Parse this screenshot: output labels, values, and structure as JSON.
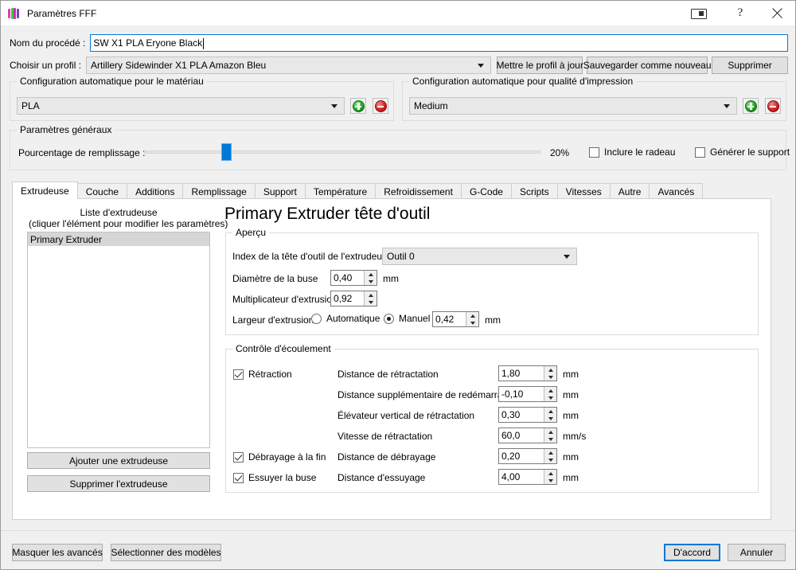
{
  "window": {
    "title": "Paramètres FFF",
    "icon": "fff-logo-icon",
    "controls": {
      "restore": "restore-icon",
      "help": "?",
      "close": "close-icon"
    }
  },
  "top": {
    "process_name_label": "Nom du procédé :",
    "process_name_value": "SW X1 PLA Eryone Black",
    "profile_label": "Choisir un profil :",
    "profile_value": "Artillery Sidewinder X1 PLA Amazon Bleu",
    "update_profile_button": "Mettre le profil à jour",
    "save_as_new_button": "Sauvegarder comme nouveau",
    "delete_button": "Supprimer"
  },
  "material_group": {
    "title": "Configuration automatique pour le matériau",
    "value": "PLA",
    "add_button": "add-icon",
    "remove_button": "remove-icon"
  },
  "quality_group": {
    "title": "Configuration automatique pour qualité d'impression",
    "value": "Medium",
    "add_button": "add-icon",
    "remove_button": "remove-icon"
  },
  "general_group": {
    "title": "Paramètres généraux",
    "infill_label": "Pourcentage de remplissage :",
    "infill_value": "20%",
    "infill_percent": 20,
    "raft_label": "Inclure le radeau",
    "raft_checked": false,
    "support_label": "Générer le support",
    "support_checked": false
  },
  "tabs": [
    {
      "label": "Extrudeuse",
      "active": true
    },
    {
      "label": "Couche",
      "active": false
    },
    {
      "label": "Additions",
      "active": false
    },
    {
      "label": "Remplissage",
      "active": false
    },
    {
      "label": "Support",
      "active": false
    },
    {
      "label": "Température",
      "active": false
    },
    {
      "label": "Refroidissement",
      "active": false
    },
    {
      "label": "G-Code",
      "active": false
    },
    {
      "label": "Scripts",
      "active": false
    },
    {
      "label": "Vitesses",
      "active": false
    },
    {
      "label": "Autre",
      "active": false
    },
    {
      "label": "Avancés",
      "active": false
    }
  ],
  "extruder_panel": {
    "list_title_line1": "Liste d'extrudeuse",
    "list_title_line2": "(cliquer l'élément pour modifier les paramètres)",
    "items": [
      "Primary Extruder"
    ],
    "add_extruder_button": "Ajouter une extrudeuse",
    "remove_extruder_button": "Supprimer l'extrudeuse"
  },
  "detail": {
    "heading": "Primary Extruder tête d'outil",
    "overview": {
      "title": "Aperçu",
      "toolhead_index_label": "Index de la tête d'outil de l'extrudeuse",
      "toolhead_index_value": "Outil 0",
      "nozzle_diameter_label": "Diamètre de la buse",
      "nozzle_diameter_value": "0,40",
      "nozzle_diameter_unit": "mm",
      "extrusion_multiplier_label": "Multiplicateur d'extrusion",
      "extrusion_multiplier_value": "0,92",
      "extrusion_width_label": "Largeur d'extrusion",
      "extrusion_width_auto_label": "Automatique",
      "extrusion_width_manual_label": "Manuel",
      "extrusion_width_mode": "manual",
      "extrusion_width_value": "0,42",
      "extrusion_width_unit": "mm"
    },
    "flow": {
      "title": "Contrôle d'écoulement",
      "retraction_checkbox_label": "Rétraction",
      "retraction_checked": true,
      "coast_checkbox_label": "Débrayage à la fin",
      "coast_checked": true,
      "wipe_checkbox_label": "Essuyer la buse",
      "wipe_checked": true,
      "rows": [
        {
          "label": "Distance de rétractation",
          "value": "1,80",
          "unit": "mm"
        },
        {
          "label": "Distance supplémentaire de redémarrage",
          "value": "-0,10",
          "unit": "mm"
        },
        {
          "label": "Élévateur vertical de rétractation",
          "value": "0,30",
          "unit": "mm"
        },
        {
          "label": "Vitesse de rétractation",
          "value": "60,0",
          "unit": "mm/s"
        },
        {
          "label": "Distance de débrayage",
          "value": "0,20",
          "unit": "mm"
        },
        {
          "label": "Distance d'essuyage",
          "value": "4,00",
          "unit": "mm"
        }
      ]
    }
  },
  "footer": {
    "hide_advanced_button": "Masquer les avancés",
    "select_models_button": "Sélectionner des modèles",
    "ok_button": "D'accord",
    "cancel_button": "Annuler"
  },
  "colors": {
    "accent": "#0078d7",
    "window_bg": "#f0f0f0",
    "panel_bg": "#ffffff",
    "add_green": "#28a428",
    "remove_red": "#d02424"
  }
}
